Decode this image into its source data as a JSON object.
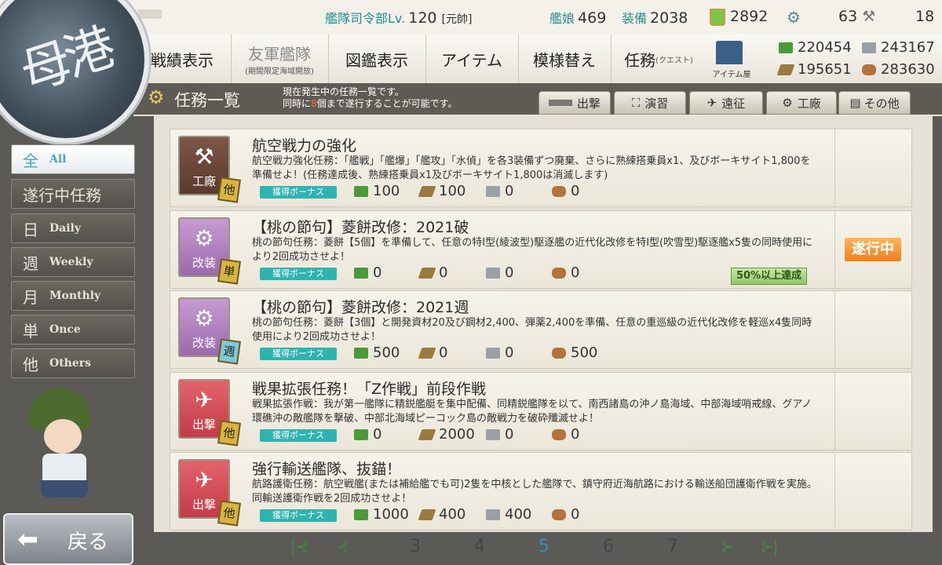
{
  "top": {
    "hq_label": "艦隊司令部Lv.",
    "hq_level": "120",
    "rank": "[元帥]",
    "ships_label": "艦娘",
    "ships": "469",
    "equip_label": "装備",
    "equip": "2038",
    "buckets": "2892",
    "screws": "63",
    "dev": "18"
  },
  "menu": [
    {
      "label": "戦績表示",
      "sub": ""
    },
    {
      "label": "友軍艦隊",
      "sub": "(期間限定海域開放)"
    },
    {
      "label": "図鑑表示",
      "sub": ""
    },
    {
      "label": "アイテム",
      "sub": ""
    },
    {
      "label": "模様替え",
      "sub": ""
    },
    {
      "label": "任務",
      "sub": "(クエスト)"
    }
  ],
  "item_shop_label": "アイテム屋",
  "resources": {
    "fuel": "220454",
    "steel": "243167",
    "ammo": "195651",
    "bauxite": "283630"
  },
  "header": {
    "title": "任務一覧",
    "desc_line1": "現在発生中の任務一覧です。",
    "desc_line2a": "同時に",
    "desc_line2b": "8",
    "desc_line2c": "個まで遂行することが可能です。"
  },
  "category_tabs": [
    "出撃",
    "演習",
    "遠征",
    "工廠",
    "その他"
  ],
  "sidebar": [
    {
      "jp": "全",
      "en": "All"
    },
    {
      "jp": "遂行中任務",
      "en": ""
    },
    {
      "jp": "日",
      "en": "Daily"
    },
    {
      "jp": "週",
      "en": "Weekly"
    },
    {
      "jp": "月",
      "en": "Monthly"
    },
    {
      "jp": "単",
      "en": "Once"
    },
    {
      "jp": "他",
      "en": "Others"
    }
  ],
  "logo_text": "母港",
  "bonus_label": "獲得ボーナス",
  "quests": [
    {
      "category": "工廠",
      "freq": "他",
      "title": "航空戦力の強化",
      "desc": "航空戦力強化任務：「艦戦」「艦爆」「艦攻」「水偵」を各3装備ずつ廃棄、さらに熟練搭乗員x1、及びボーキサイト1,800を準備せよ！(任務達成後、熟練搭乗員x1及びボーキサイト1,800は消滅します)",
      "fuel": "100",
      "ammo": "100",
      "steel": "0",
      "bauxite": "0",
      "progress": "",
      "status": ""
    },
    {
      "category": "改装",
      "freq": "単",
      "title": "【桃の節句】菱餅改修：2021破",
      "desc": "桃の節句任務：菱餅【5個】を準備して、任意の特I型(綾波型)駆逐艦の近代化改修を特I型(吹雪型)駆逐艦x5隻の同時使用により2回成功させよ！",
      "fuel": "0",
      "ammo": "0",
      "steel": "0",
      "bauxite": "0",
      "progress": "50%以上達成",
      "status": "遂行中"
    },
    {
      "category": "改装",
      "freq": "週",
      "title": "【桃の節句】菱餅改修：2021週",
      "desc": "桃の節句任務：菱餅【3個】と開発資材20及び鋼材2,400、弾薬2,400を準備、任意の重巡級の近代化改修を軽巡x4隻同時使用により2回成功させよ！",
      "fuel": "500",
      "ammo": "0",
      "steel": "0",
      "bauxite": "500",
      "progress": "",
      "status": ""
    },
    {
      "category": "出撃",
      "freq": "他",
      "title": "戦果拡張任務！「Z作戦」前段作戦",
      "desc": "戦果拡張作戦：我が第一艦隊に精鋭艦艇を集中配備、同精鋭艦隊を以て、南西諸島の沖ノ島海域、中部海域哨戒線、グアノ環礁沖の敵艦隊を撃破、中部北海域ピーコック島の敵戦力を破砕殲滅せよ！",
      "fuel": "0",
      "ammo": "2000",
      "steel": "0",
      "bauxite": "0",
      "progress": "",
      "status": ""
    },
    {
      "category": "出撃",
      "freq": "他",
      "title": "強行輸送艦隊、抜錨！",
      "desc": "航路護衛任務：航空戦艦(または補給艦でも可)2隻を中核とした艦隊で、鎮守府近海航路における輸送船団護衛作戦を実施。同輸送護衛作戦を2回成功させよ！",
      "fuel": "1000",
      "ammo": "400",
      "steel": "400",
      "bauxite": "0",
      "progress": "",
      "status": ""
    }
  ],
  "back_label": "戻る",
  "pages": [
    "3",
    "4",
    "5",
    "6",
    "7"
  ],
  "current_page": "5",
  "colors": {
    "accent": "#2fb3b0",
    "status_orange": "#f07f1e",
    "header_bg": "#5e5b55"
  }
}
